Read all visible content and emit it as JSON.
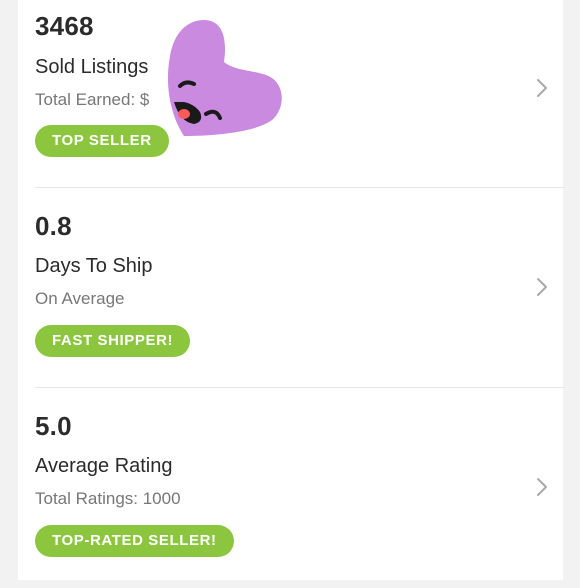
{
  "stats": [
    {
      "value": "3468",
      "title": "Sold Listings",
      "subtitle": "Total Earned: $",
      "badge": "TOP SELLER"
    },
    {
      "value": "0.8",
      "title": "Days To Ship",
      "subtitle": "On Average",
      "badge": "FAST SHIPPER!"
    },
    {
      "value": "5.0",
      "title": "Average Rating",
      "subtitle": "Total Ratings: 1000",
      "badge": "TOP-RATED SELLER!"
    }
  ],
  "colors": {
    "badge_green": "#8cc63f",
    "heart_purple": "#c98ae0",
    "text_dark": "#2b2b2b",
    "text_muted": "#777777",
    "chevron": "#a9a9a9"
  },
  "icons": {
    "chevron": "chevron-right-icon",
    "sticker": "heart-face-sticker-icon"
  }
}
